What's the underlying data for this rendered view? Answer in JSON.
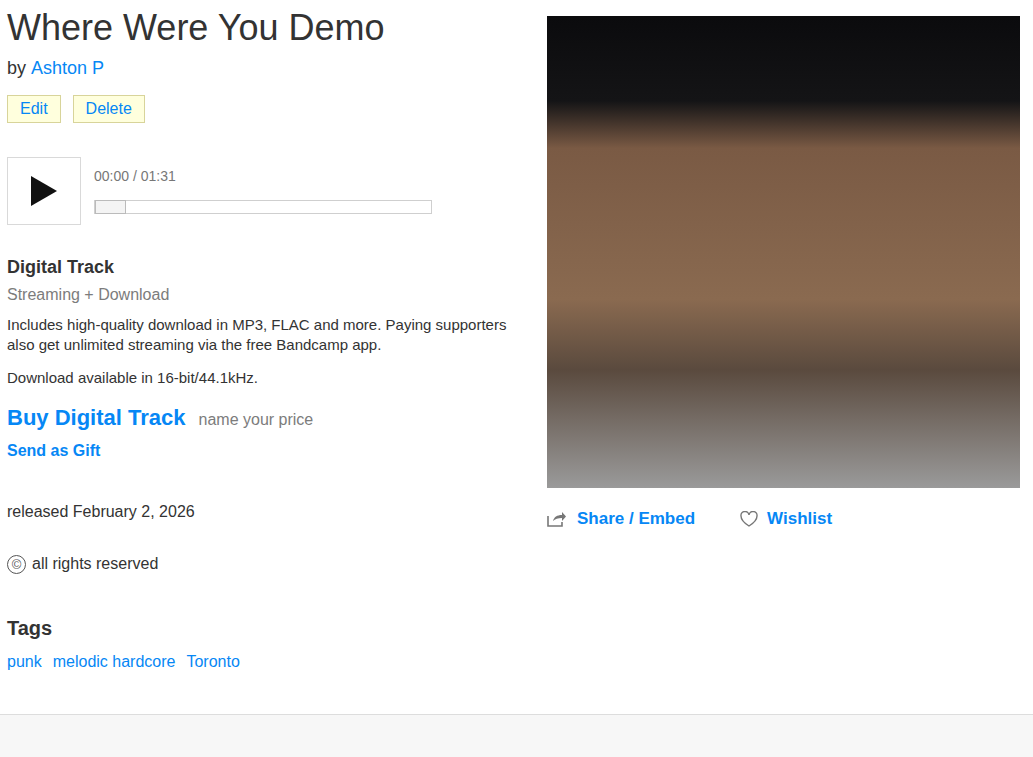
{
  "title": "Where Were You Demo",
  "artist": {
    "prefix": "by",
    "name": "Ashton P"
  },
  "actions": [
    "Edit",
    "Delete"
  ],
  "player": {
    "time": "00:00 / 01:31",
    "level": 0
  },
  "purchase": {
    "heading": "Digital Track",
    "format": "Streaming + Download",
    "description": "Includes high-quality download in MP3, FLAC and more. Paying supporters also get unlimited streaming via the free Bandcamp app.",
    "quality": "Download available in 16-bit/44.1kHz.",
    "buy": "Buy Digital Track",
    "price_note": "name your price",
    "gift": "Send as Gift"
  },
  "released": "released February 2, 2026",
  "license": {
    "symbol": "©",
    "text": "all rights reserved"
  },
  "tags": {
    "heading": "Tags",
    "items": [
      "punk",
      "melodic hardcore",
      "Toronto"
    ]
  },
  "share": "Share / Embed",
  "wishlist": "Wishlist"
}
